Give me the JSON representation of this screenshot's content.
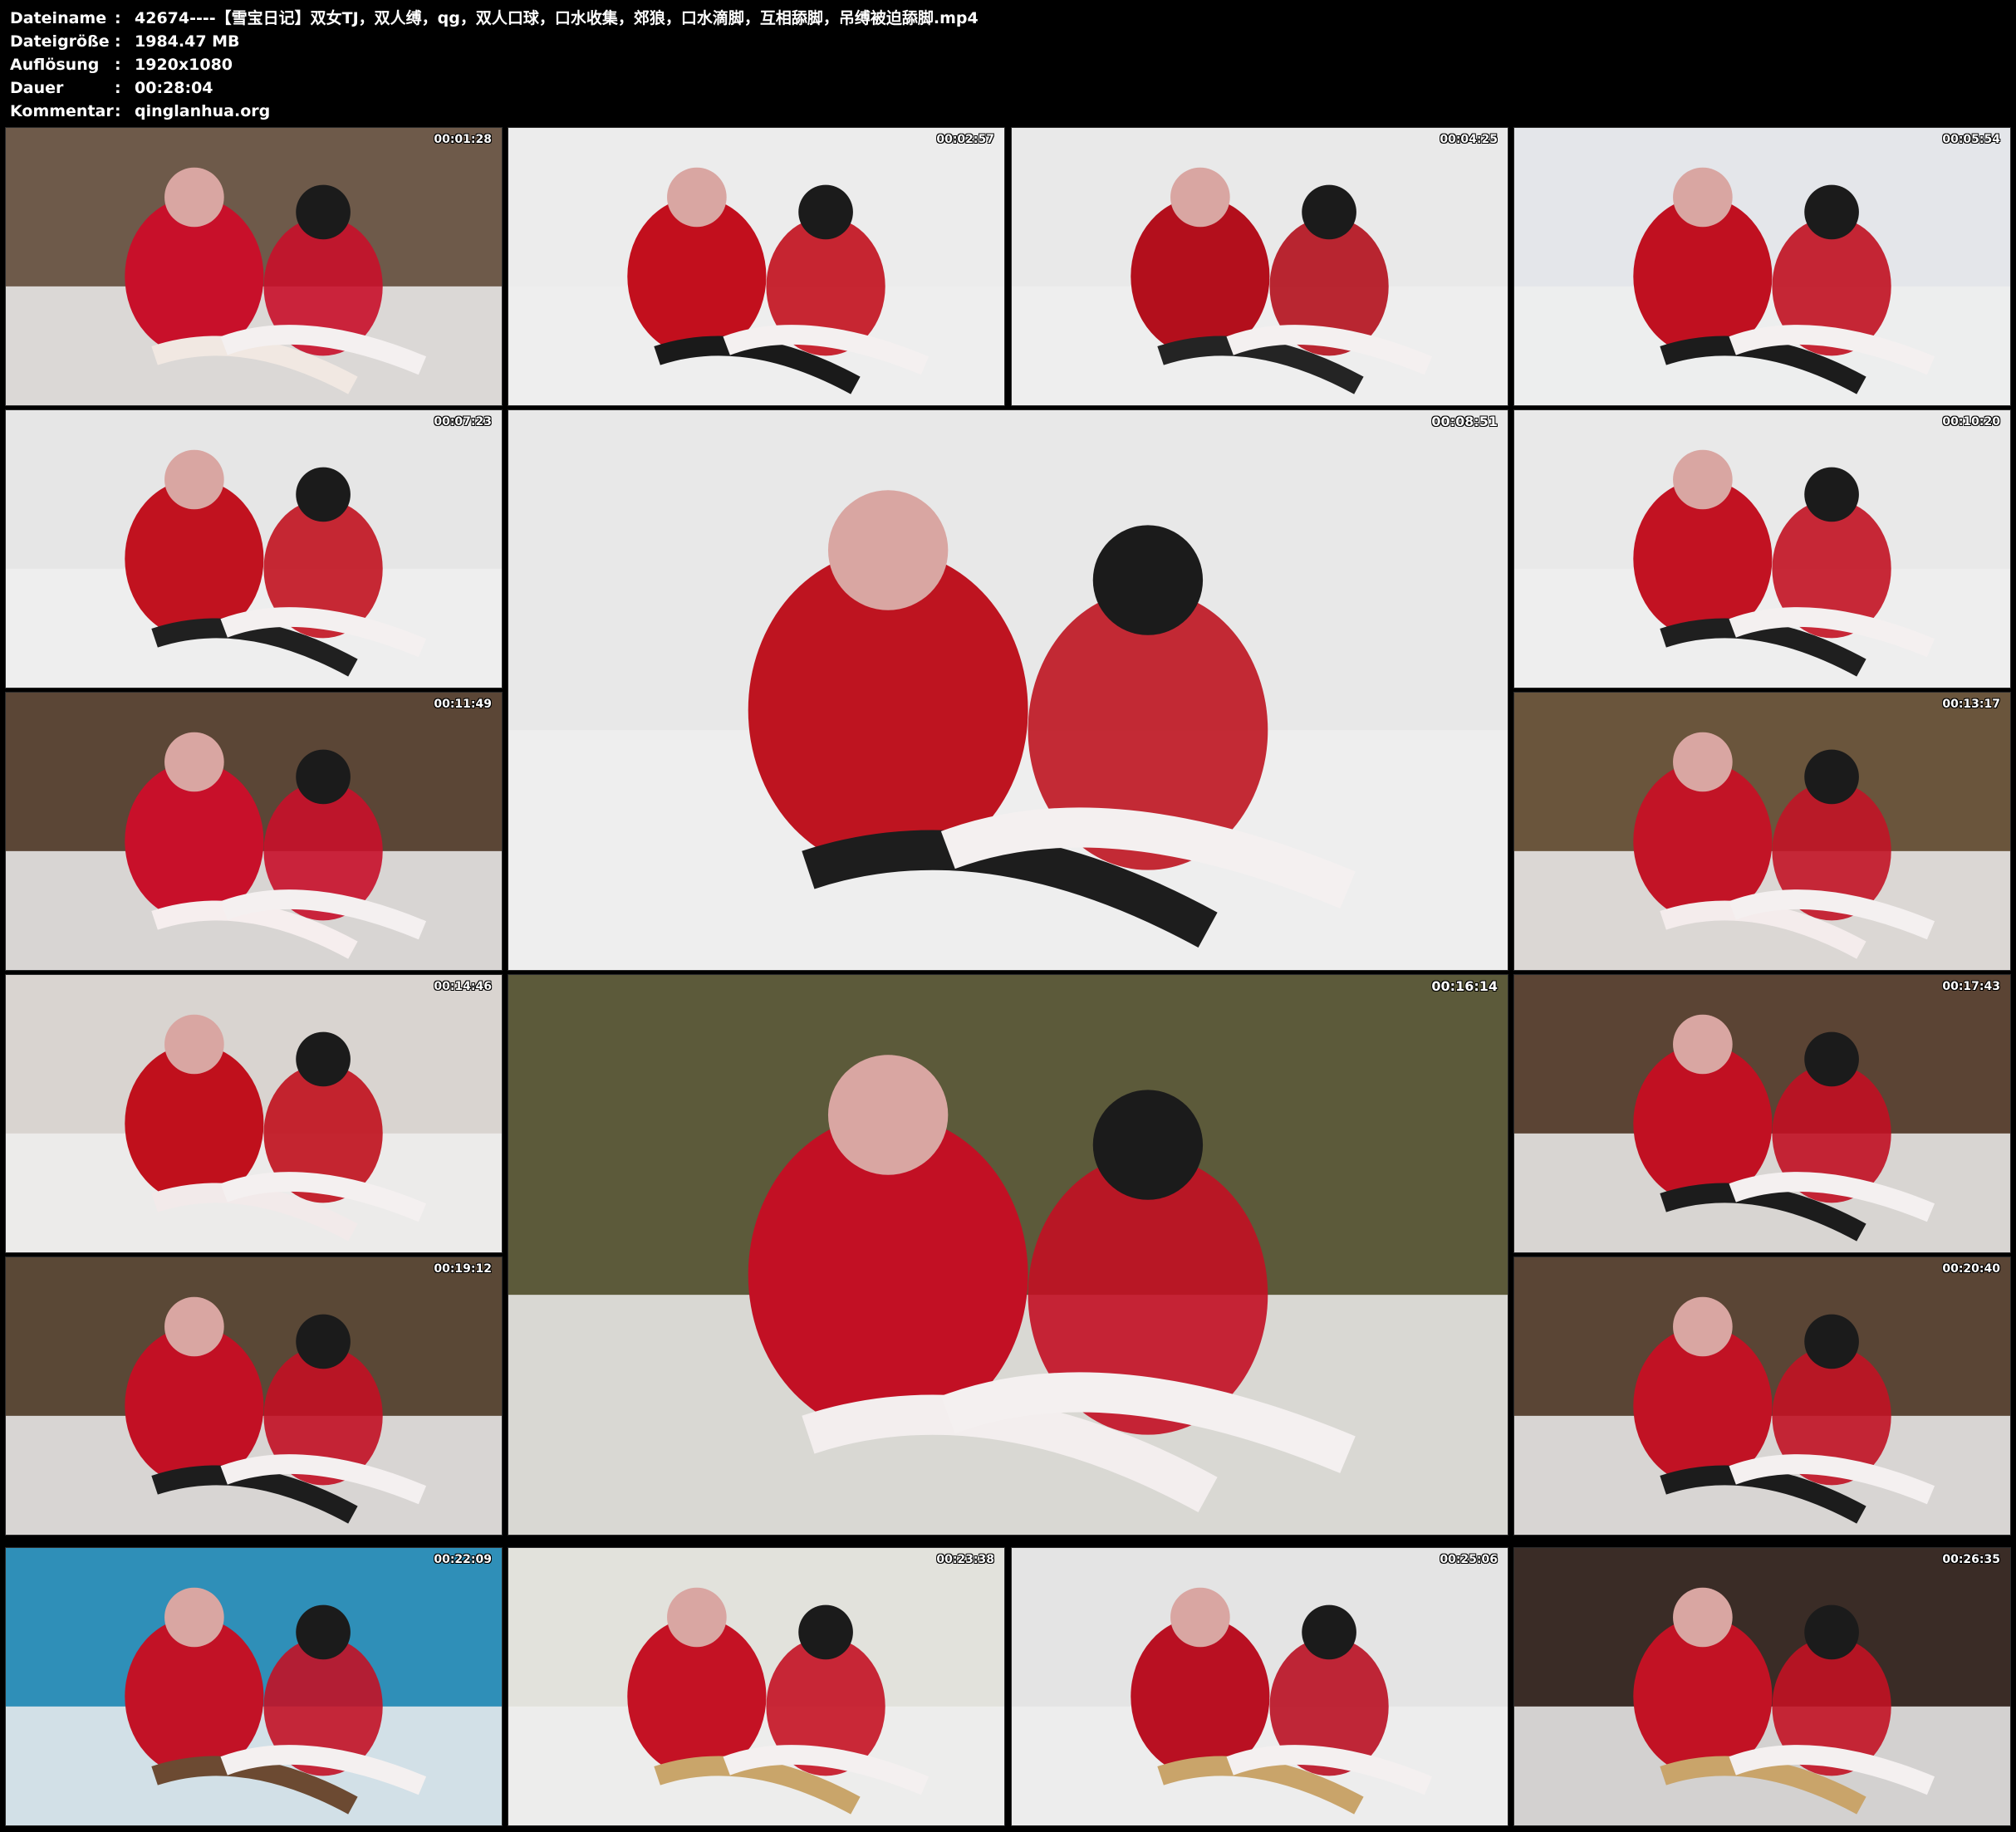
{
  "info": [
    {
      "label": "Dateiname",
      "value": "42674----【雪宝日记】双女TJ，双人缚，qg，双人口球，口水收集，郊狼，口水滴脚，互相舔脚，吊缚被迫舔脚.mp4"
    },
    {
      "label": "Dateigröße",
      "value": "1984.47 MB"
    },
    {
      "label": "Auflösung",
      "value": "1920x1080"
    },
    {
      "label": "Dauer",
      "value": "00:28:04"
    },
    {
      "label": "Kommentar",
      "value": "qinglanhua.org"
    }
  ],
  "separator": ":",
  "thumbnails": [
    {
      "time": "00:01:28",
      "scene": "two-girls-mask-closeup"
    },
    {
      "time": "00:02:57",
      "scene": "two-girls-bed-legs"
    },
    {
      "time": "00:04:25",
      "scene": "two-girls-seated-bed"
    },
    {
      "time": "00:05:54",
      "scene": "two-girls-legs-raised"
    },
    {
      "time": "00:07:23",
      "scene": "two-girls-bed-side"
    },
    {
      "time": "00:08:51",
      "scene": "two-girls-embrace-bed"
    },
    {
      "time": "00:10:20",
      "scene": "two-girls-seated-legs-crossed"
    },
    {
      "time": "00:11:49",
      "scene": "blindfold-foot-closeup"
    },
    {
      "time": "00:13:17",
      "scene": "two-girls-headboard"
    },
    {
      "time": "00:14:46",
      "scene": "blindfold-foot-closeup-2"
    },
    {
      "time": "00:16:14",
      "scene": "blindfold-foot-headboard"
    },
    {
      "time": "00:17:43",
      "scene": "two-girls-foot-licking"
    },
    {
      "time": "00:19:12",
      "scene": "two-girls-foot-licking-2"
    },
    {
      "time": "00:20:40",
      "scene": "two-girls-foot-licking-3"
    },
    {
      "time": "00:22:09",
      "scene": "suspension-room"
    },
    {
      "time": "00:23:38",
      "scene": "rope-tied-floor"
    },
    {
      "time": "00:25:06",
      "scene": "rope-tied-seated"
    },
    {
      "time": "00:26:35",
      "scene": "rope-gag-closeup"
    }
  ],
  "colors": {
    "background": "#000000",
    "text": "#ffffff",
    "costume_red": "#c0101a",
    "sheet_white": "#eeeeee"
  }
}
